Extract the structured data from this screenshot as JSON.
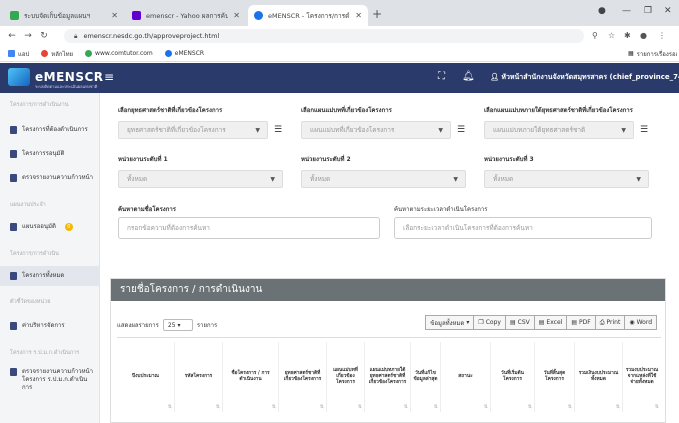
{
  "browser": {
    "tabs": [
      {
        "title": "ระบบจัดเก็บข้อมูลแผนฯ",
        "active": false,
        "favicon_color": "#34a853"
      },
      {
        "title": "emenscr - Yahoo ผลการค้นหา",
        "active": false,
        "favicon_color": "#6001d2"
      },
      {
        "title": "eMENSCR - โครงการ/การดำเนินงาน",
        "active": true,
        "favicon_color": "#1a73e8"
      }
    ],
    "new_tab": "+",
    "window_controls": [
      "—",
      "❐",
      "✕"
    ],
    "url": "emenscr.nesdc.go.th/approveproject.html",
    "bookmarks": [
      {
        "label": "แอป",
        "color": "#4285f4"
      },
      {
        "label": "หลักไทย",
        "color": "#ea4335"
      },
      {
        "label": "www.comtutor.com",
        "color": "#34a853"
      },
      {
        "label": "eMENSCR",
        "color": "#1a73e8"
      }
    ],
    "reading_list": "รายการเรื่องรออ่าน"
  },
  "app": {
    "logo_text": "eMENSCR",
    "logo_sub": "ระบบติดตามและประเมินผลแห่งชาติ",
    "user_label": "หัวหน้าสำนักงานจังหวัดสมุทรสาคร (chief_province_74)"
  },
  "sidebar": {
    "sections": [
      {
        "title": "โครงการ/การดำเนินงาน",
        "items": [
          {
            "label": "โครงการที่ต้องดำเนินการ"
          },
          {
            "label": "โครงการรอนุมัติ"
          },
          {
            "label": "ตรวจรายงานความก้าวหน้า"
          }
        ]
      },
      {
        "title": "แผนงานประจำ",
        "items": [
          {
            "label": "แผนรออนุมัติ",
            "badge": "0"
          }
        ]
      },
      {
        "title": "โครงการ/การดำเนิน",
        "items": [
          {
            "label": "โครงการทั้งหมด",
            "active": true
          }
        ]
      },
      {
        "title": "ตัวชี้วัดของหน่วย",
        "items": [
          {
            "label": "ค่าบริหารจัดการ"
          }
        ]
      },
      {
        "title": "โครงการ ร.ป.ม.ก.ดำเนินการ",
        "items": [
          {
            "label": "ตรวจรายงานความก้าวหน้าโครงการ ร.ป.ม.ก.ดำเนินการ"
          }
        ]
      }
    ]
  },
  "filters": {
    "strategy": {
      "label": "เลือกยุทธศาสตร์ชาติที่เกี่ยวข้องโครงการ",
      "placeholder": "ยุทธศาสตร์ชาติที่เกี่ยวข้องโครงการ"
    },
    "master_plan": {
      "label": "เลือกแผนแม่บทที่เกี่ยวข้องโครงการ",
      "placeholder": "แผนแม่บทที่เกี่ยวข้องโครงการ"
    },
    "sub_plan": {
      "label": "เลือกแผนแม่บทภายใต้ยุทธศาสตร์ชาติที่เกี่ยวข้องโครงการ",
      "placeholder": "แผนแม่บทภายใต้ยุทธศาสตร์ชาติ"
    },
    "org1": {
      "label": "หน่วยงานระดับที่ 1",
      "value": "ทั้งหมด"
    },
    "org2": {
      "label": "หน่วยงานระดับที่ 2",
      "value": "ทั้งหมด"
    },
    "org3": {
      "label": "หน่วยงานระดับที่ 3",
      "value": "ทั้งหมด"
    },
    "search_project": {
      "label": "ค้นหาตามชื่อโครงการ",
      "placeholder": "กรอกข้อความที่ต้องการค้นหา"
    },
    "period": {
      "label": "ค้นหาตามระยะเวลาดำเนินโครงการ",
      "placeholder": "เลือกระยะเวลาดำเนินโครงการที่ต้องการค้นหา"
    }
  },
  "results": {
    "title": "รายชื่อโครงการ / การดำเนินงาน",
    "show_prefix": "แสดงผลรายการ",
    "show_value": "25",
    "show_suffix": "รายการ",
    "tools": [
      {
        "label": "ข้อมูลทั้งหมด",
        "icon": "▾"
      },
      {
        "label": "Copy",
        "icon": "❐"
      },
      {
        "label": "CSV",
        "icon": "▤"
      },
      {
        "label": "Excel",
        "icon": "▤"
      },
      {
        "label": "PDF",
        "icon": "▤"
      },
      {
        "label": "Print",
        "icon": "⎙"
      },
      {
        "label": "Word",
        "icon": "◉"
      }
    ],
    "columns": [
      "ปีงบประมาณ",
      "รหัสโครงการ",
      "ชื่อโครงการ / การดำเนินงาน",
      "ยุทธศาสตร์ชาติที่เกี่ยวข้องโครงการ",
      "แผนแม่บทที่เกี่ยวข้องโครงการ",
      "แผนแม่บทภายใต้ยุทธศาสตร์ชาติที่เกี่ยวข้องโครงการ",
      "วันที่แก้ไขข้อมูลล่าสุด",
      "สถานะ",
      "วันที่เริ่มต้นโครงการ",
      "วันที่สิ้นสุดโครงการ",
      "รวมเงินงบประมาณทั้งหมด",
      "รวมงบประมาณจากแหล่งที่ใช้จ่ายทั้งหมด"
    ]
  }
}
